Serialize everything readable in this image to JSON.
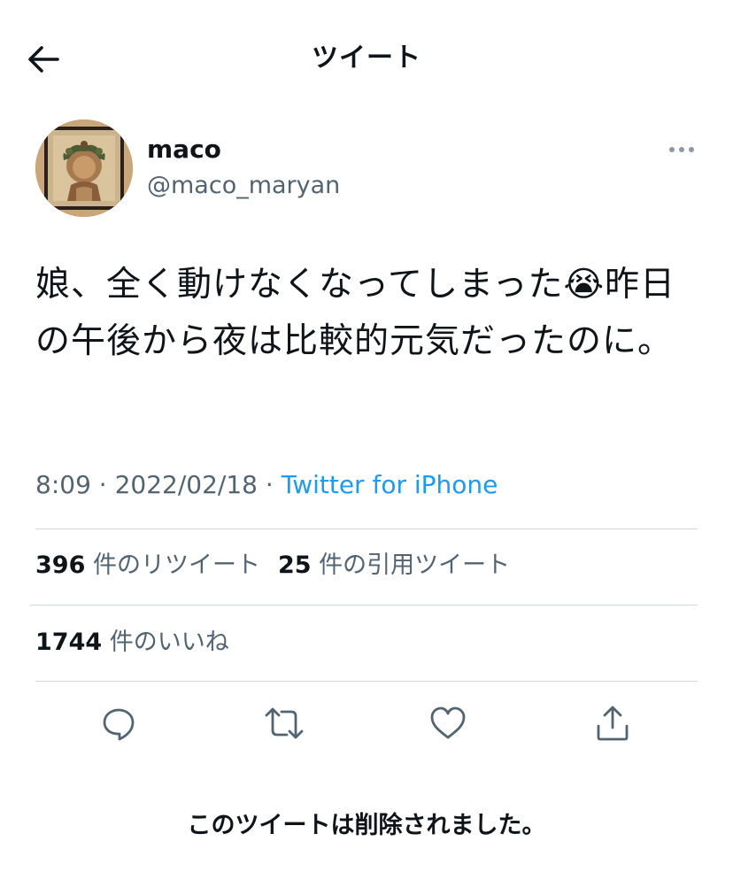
{
  "header": {
    "title": "ツイート",
    "back_icon": "arrow-left-icon"
  },
  "author": {
    "display_name": "maco",
    "handle": "@maco_maryan",
    "avatar": "mosaic-portrait"
  },
  "tweet": {
    "text": "娘、全く動けなくなってしまった😭昨日の午後から夜は比較的元気だったのに。",
    "time": "8:09",
    "separator": "·",
    "date": "2022/02/18",
    "source": "Twitter for iPhone"
  },
  "stats": {
    "retweets": {
      "count": "396",
      "label": "件のリツイート"
    },
    "quotes": {
      "count": "25",
      "label": "件の引用ツイート"
    },
    "likes": {
      "count": "1744",
      "label": "件のいいね"
    }
  },
  "actions": {
    "reply": "reply-icon",
    "retweet": "retweet-icon",
    "like": "heart-icon",
    "share": "share-icon"
  },
  "notice": {
    "text": "このツイートは削除されました。"
  },
  "colors": {
    "text": "#0f1419",
    "secondary": "#536471",
    "link": "#1d9bf0",
    "divider": "#cfd9de"
  }
}
